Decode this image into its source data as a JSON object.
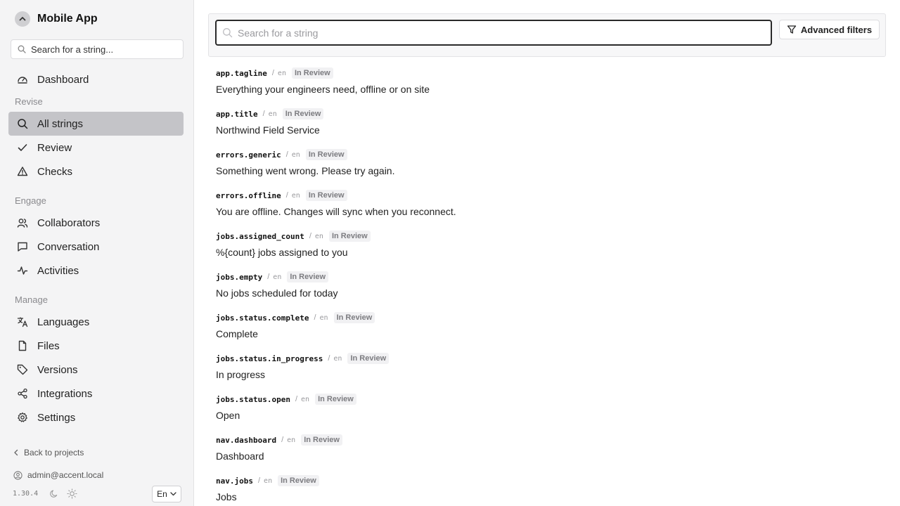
{
  "sidebar": {
    "project_title": "Mobile App",
    "search_placeholder": "Search for a string...",
    "nav": {
      "dashboard": "Dashboard",
      "all_strings": "All strings",
      "review": "Review",
      "checks": "Checks",
      "collaborators": "Collaborators",
      "conversation": "Conversation",
      "activities": "Activities",
      "languages": "Languages",
      "files": "Files",
      "versions": "Versions",
      "integrations": "Integrations",
      "settings": "Settings"
    },
    "sections": {
      "revise": "Revise",
      "engage": "Engage",
      "manage": "Manage"
    },
    "back_link": "Back to projects",
    "user_email": "admin@accent.local",
    "app_version": "1.30.4",
    "language": "En"
  },
  "main": {
    "search_placeholder": "Search for a string",
    "advanced_filters_label": "Advanced filters",
    "strings": [
      {
        "key": "app.tagline",
        "locale": "en",
        "status": "In Review",
        "value": "Everything your engineers need, offline or on site"
      },
      {
        "key": "app.title",
        "locale": "en",
        "status": "In Review",
        "value": "Northwind Field Service"
      },
      {
        "key": "errors.generic",
        "locale": "en",
        "status": "In Review",
        "value": "Something went wrong. Please try again."
      },
      {
        "key": "errors.offline",
        "locale": "en",
        "status": "In Review",
        "value": "You are offline. Changes will sync when you reconnect."
      },
      {
        "key": "jobs.assigned_count",
        "locale": "en",
        "status": "In Review",
        "value": "%{count} jobs assigned to you"
      },
      {
        "key": "jobs.empty",
        "locale": "en",
        "status": "In Review",
        "value": "No jobs scheduled for today"
      },
      {
        "key": "jobs.status.complete",
        "locale": "en",
        "status": "In Review",
        "value": "Complete"
      },
      {
        "key": "jobs.status.in_progress",
        "locale": "en",
        "status": "In Review",
        "value": "In progress"
      },
      {
        "key": "jobs.status.open",
        "locale": "en",
        "status": "In Review",
        "value": "Open"
      },
      {
        "key": "nav.dashboard",
        "locale": "en",
        "status": "In Review",
        "value": "Dashboard"
      },
      {
        "key": "nav.jobs",
        "locale": "en",
        "status": "In Review",
        "value": "Jobs"
      }
    ]
  }
}
